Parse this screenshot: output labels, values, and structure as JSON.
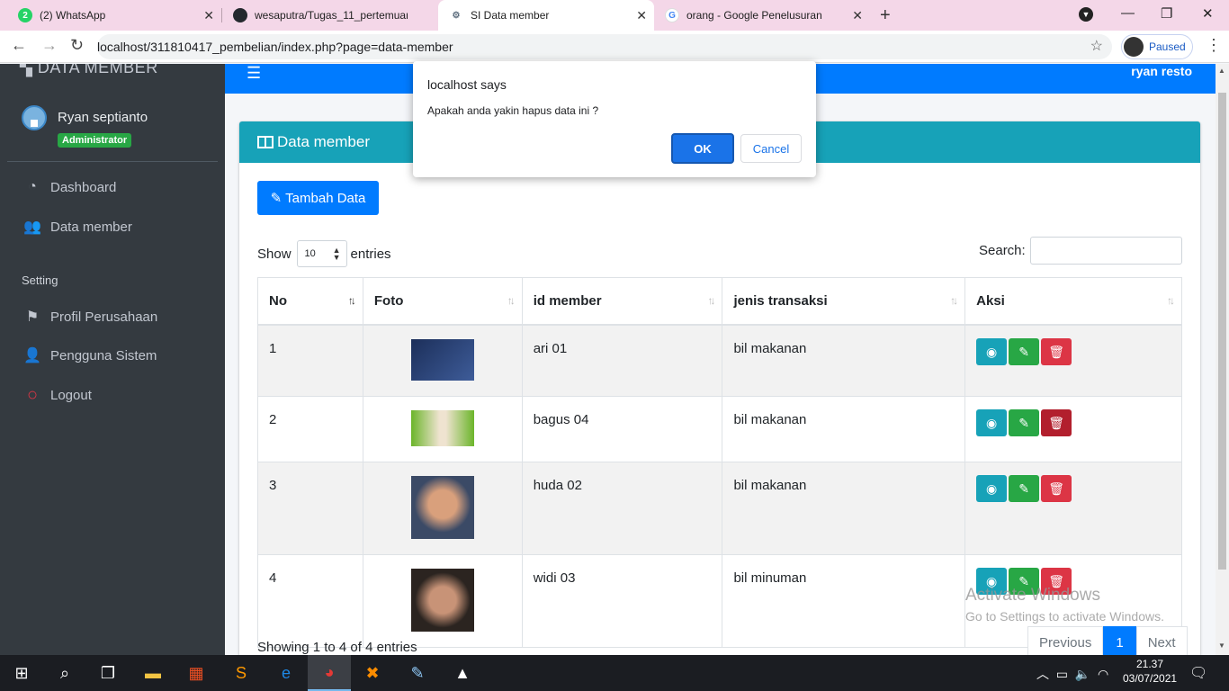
{
  "browser": {
    "tabs": [
      {
        "title": "(2) WhatsApp",
        "favicon_color": "#25d366",
        "favicon_text": "2"
      },
      {
        "title": "wesaputra/Tugas_11_pertemuan_",
        "favicon_color": "#24292e",
        "favicon_text": ""
      },
      {
        "title": "SI Data member",
        "favicon_color": "#5b6c7c",
        "favicon_text": ""
      },
      {
        "title": "orang - Google Penelusuran",
        "favicon_color": "#4285f4",
        "favicon_text": "G"
      }
    ],
    "url": "localhost/311810417_pembelian/index.php?page=data-member",
    "profile_status": "Paused"
  },
  "sidebar": {
    "brand": "DATA MEMBER",
    "user_name": "Ryan septianto",
    "user_role": "Administrator",
    "menu": [
      {
        "label": "Dashboard",
        "icon": "dashboard-icon"
      },
      {
        "label": "Data member",
        "icon": "users-icon"
      }
    ],
    "setting_header": "Setting",
    "setting_menu": [
      {
        "label": "Profil Perusahaan",
        "icon": "flag-icon"
      },
      {
        "label": "Pengguna Sistem",
        "icon": "user-icon"
      },
      {
        "label": "Logout",
        "icon": "logout-circle-icon"
      }
    ]
  },
  "topbar": {
    "title": "ryan resto"
  },
  "card": {
    "title": "Data member",
    "add_button": "Tambah Data",
    "show_label": "Show",
    "entries_value": "10",
    "entries_label": "entries",
    "search_label": "Search:",
    "columns": [
      "No",
      "Foto",
      "id member",
      "jenis transaksi",
      "Aksi"
    ],
    "rows": [
      {
        "no": "1",
        "id_member": "ari 01",
        "jenis_transaksi": "bil makanan"
      },
      {
        "no": "2",
        "id_member": "bagus 04",
        "jenis_transaksi": "bil makanan"
      },
      {
        "no": "3",
        "id_member": "huda 02",
        "jenis_transaksi": "bil makanan"
      },
      {
        "no": "4",
        "id_member": "widi 03",
        "jenis_transaksi": "bil minuman"
      }
    ],
    "info": "Showing 1 to 4 of 4 entries",
    "pager": {
      "previous": "Previous",
      "current": "1",
      "next": "Next"
    }
  },
  "watermark": {
    "line1": "Activate Windows",
    "line2": "Go to Settings to activate Windows."
  },
  "dialog": {
    "title": "localhost says",
    "message": "Apakah anda yakin hapus data ini ?",
    "ok": "OK",
    "cancel": "Cancel"
  },
  "taskbar": {
    "time": "21.37",
    "date": "03/07/2021"
  },
  "colors": {
    "primary": "#007bff",
    "info": "#17a2b8",
    "success": "#28a745",
    "danger": "#dc3545",
    "sidebar": "#343a40"
  }
}
